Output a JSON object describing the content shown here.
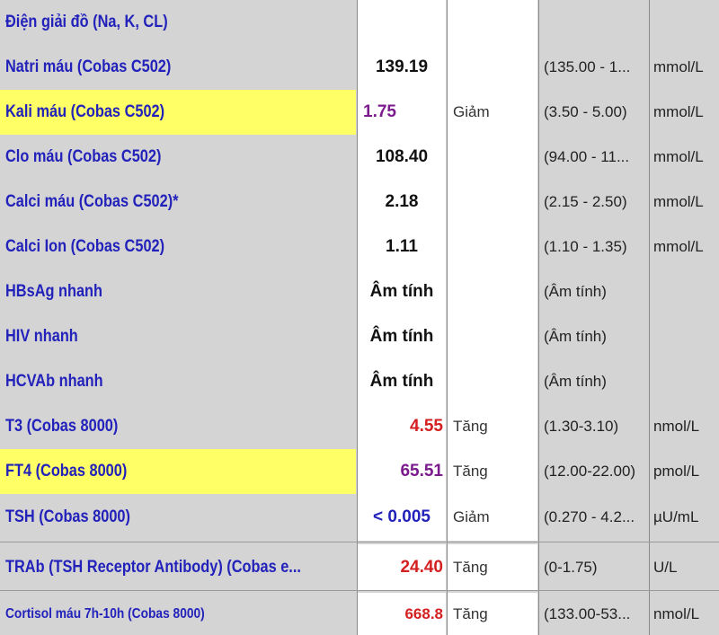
{
  "rows": [
    {
      "name": "Điện giải đồ (Na, K, CL)",
      "value": "",
      "flag": "",
      "range": "",
      "unit": "",
      "highlight": false,
      "value_color": "#111111",
      "align": "center"
    },
    {
      "name": "Natri máu (Cobas C502)",
      "value": "139.19",
      "flag": "",
      "range": "(135.00 - 1...",
      "unit": "mmol/L",
      "highlight": false,
      "value_color": "#111111",
      "align": "center"
    },
    {
      "name": "Kali máu (Cobas C502)",
      "value": "1.75",
      "flag": "Giảm",
      "range": "(3.50 - 5.00)",
      "unit": "mmol/L",
      "highlight": true,
      "value_color": "#7b1a8c",
      "align": "left"
    },
    {
      "name": "Clo máu (Cobas C502)",
      "value": "108.40",
      "flag": "",
      "range": "(94.00 - 11...",
      "unit": "mmol/L",
      "highlight": false,
      "value_color": "#111111",
      "align": "center"
    },
    {
      "name": "Calci máu (Cobas C502)*",
      "value": "2.18",
      "flag": "",
      "range": "(2.15 - 2.50)",
      "unit": "mmol/L",
      "highlight": false,
      "value_color": "#111111",
      "align": "center"
    },
    {
      "name": "Calci Ion (Cobas C502)",
      "value": "1.11",
      "flag": "",
      "range": "(1.10 - 1.35)",
      "unit": "mmol/L",
      "highlight": false,
      "value_color": "#111111",
      "align": "center"
    },
    {
      "name": "HBsAg nhanh",
      "value": "Âm tính",
      "flag": "",
      "range": "(Âm tính)",
      "unit": "",
      "highlight": false,
      "value_color": "#111111",
      "align": "center"
    },
    {
      "name": "HIV nhanh",
      "value": "Âm tính",
      "flag": "",
      "range": "(Âm tính)",
      "unit": "",
      "highlight": false,
      "value_color": "#111111",
      "align": "center"
    },
    {
      "name": "HCVAb nhanh",
      "value": "Âm tính",
      "flag": "",
      "range": "(Âm tính)",
      "unit": "",
      "highlight": false,
      "value_color": "#111111",
      "align": "center"
    },
    {
      "name": "T3 (Cobas 8000)",
      "value": "4.55",
      "flag": "Tăng",
      "range": "(1.30-3.10)",
      "unit": "nmol/L",
      "highlight": false,
      "value_color": "#d42020",
      "align": "right"
    },
    {
      "name": "FT4 (Cobas 8000)",
      "value": "65.51",
      "flag": "Tăng",
      "range": "(12.00-22.00)",
      "unit": "pmol/L",
      "highlight": true,
      "value_color": "#7b1a8c",
      "align": "right"
    },
    {
      "name": "TSH (Cobas 8000)",
      "value": "< 0.005",
      "flag": "Giảm",
      "range": "(0.270 - 4.2...",
      "unit": "µU/mL",
      "highlight": false,
      "value_color": "#2222bb",
      "align": "center"
    },
    {
      "name": "TRAb (TSH Receptor Antibody) (Cobas e...",
      "value": "24.40",
      "flag": "Tăng",
      "range": "(0-1.75)",
      "unit": "U/L",
      "highlight": false,
      "value_color": "#d42020",
      "align": "right"
    },
    {
      "name": "Cortisol máu 7h-10h (Cobas 8000)",
      "value": "668.8",
      "flag": "Tăng",
      "range": "(133.00-53...",
      "unit": "nmol/L",
      "highlight": false,
      "value_color": "#d42020",
      "align": "right"
    }
  ],
  "colors": {
    "highlight": "#ffff66",
    "name_text": "#2222bb"
  }
}
